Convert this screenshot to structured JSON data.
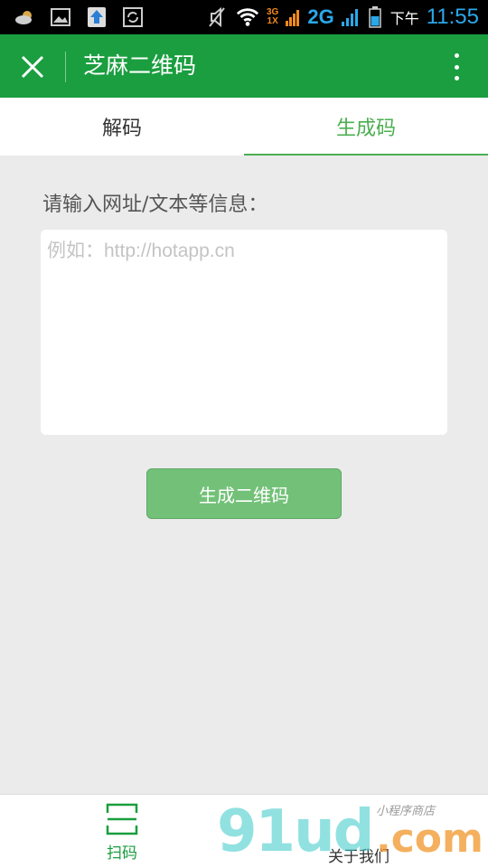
{
  "status_bar": {
    "network_top": "3G",
    "network_bottom": "1X",
    "network_2g": "2G",
    "ampm": "下午",
    "time": "11:55",
    "icons": [
      "weather-cloud-icon",
      "image-icon",
      "upload-icon",
      "sync-icon",
      "mute-icon",
      "wifi-icon",
      "signal-icon",
      "battery-icon"
    ]
  },
  "title_bar": {
    "title": "芝麻二维码",
    "close_icon": "close-icon",
    "more_icon": "more-vertical-icon"
  },
  "tabs": [
    {
      "label": "解码",
      "active": false
    },
    {
      "label": "生成码",
      "active": true
    }
  ],
  "main": {
    "prompt": "请输入网址/文本等信息：",
    "input_value": "",
    "input_placeholder": "例如：http://hotapp.cn",
    "generate_button": "生成二维码"
  },
  "bottom_nav": {
    "items": [
      {
        "label": "扫码",
        "icon": "scan-frame-icon",
        "active": true
      },
      {
        "label": "关于我们",
        "active": false
      }
    ]
  },
  "watermark": {
    "main": "91ud",
    "suffix": ".com",
    "sub": "小程序商店"
  },
  "colors": {
    "brand_green": "#1a9e3f",
    "accent_green": "#4caf50",
    "button_green": "#73c178",
    "background": "#ebebeb"
  }
}
